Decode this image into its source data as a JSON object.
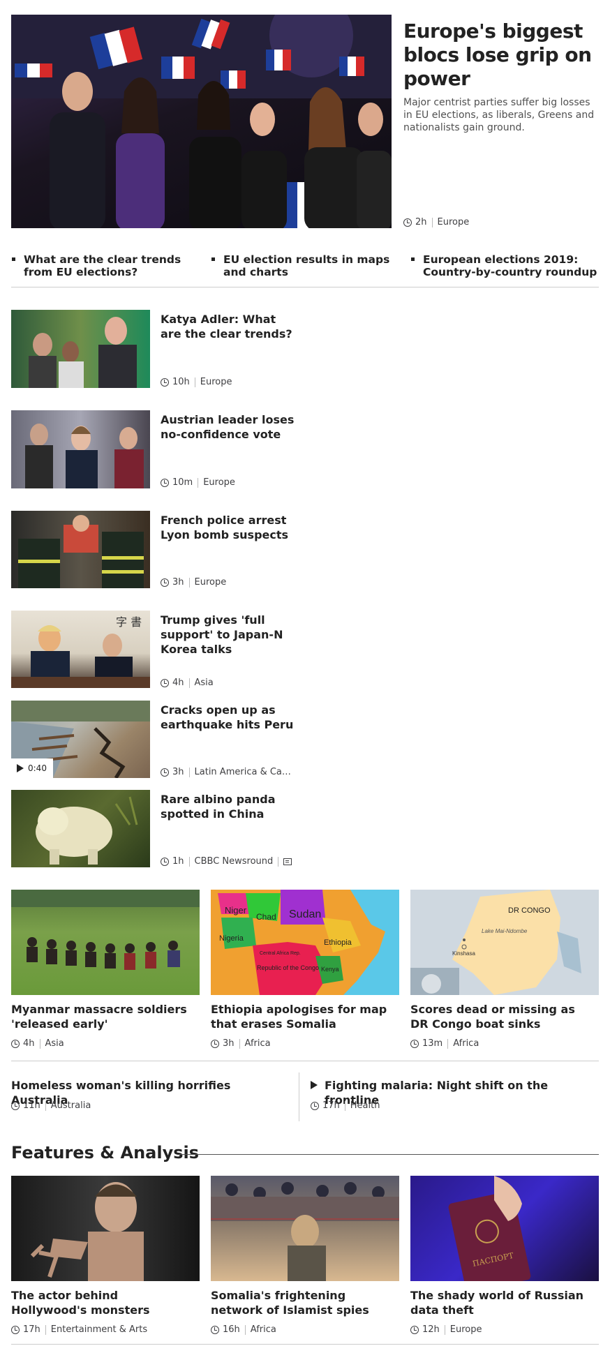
{
  "lead": {
    "headline": "Europe's biggest blocs lose grip on power",
    "summary": "Major centrist parties suffer big losses in EU elections, as liberals, Greens and nationalists gain ground.",
    "time": "2h",
    "section": "Europe"
  },
  "related_links": [
    "What are the clear trends from EU elections?",
    "EU election results in maps and charts",
    "European elections 2019: Country-by-country roundup"
  ],
  "stories": [
    {
      "headline": "Katya Adler: What are the clear trends?",
      "time": "10h",
      "section": "Europe"
    },
    {
      "headline": "Austrian leader loses no-confidence vote",
      "time": "10m",
      "section": "Europe"
    },
    {
      "headline": "French police arrest Lyon bomb suspects",
      "time": "3h",
      "section": "Europe"
    },
    {
      "headline": "Trump gives 'full support' to Japan-N Korea talks",
      "time": "4h",
      "section": "Asia"
    },
    {
      "headline": "Cracks open up as earthquake hits Peru",
      "time": "3h",
      "section": "Latin America & Ca…",
      "video_duration": "0:40"
    },
    {
      "headline": "Rare albino panda spotted in China",
      "time": "1h",
      "section": "CBBC Newsround"
    }
  ],
  "grid": [
    {
      "headline": "Myanmar massacre soldiers 'released early'",
      "time": "4h",
      "section": "Asia"
    },
    {
      "headline": "Ethiopia apologises for map that erases Somalia",
      "time": "3h",
      "section": "Africa"
    },
    {
      "headline": "Scores dead or missing as DR Congo boat sinks",
      "time": "13m",
      "section": "Africa"
    }
  ],
  "map_labels": {
    "africa": [
      "Niger",
      "Chad",
      "Sudan",
      "Nigeria",
      "Ethiopia",
      "Republic of the Congo",
      "Kenya",
      "Central Africa Rep."
    ],
    "congo": [
      "DR CONGO",
      "Lake Mai-Ndombe",
      "Kinshasa"
    ]
  },
  "text_row": [
    {
      "headline": "Homeless woman's killing horrifies Australia",
      "time": "11h",
      "section": "Australia"
    },
    {
      "headline": "Fighting malaria: Night shift on the frontline",
      "time": "17h",
      "section": "Health"
    }
  ],
  "features": {
    "title": "Features & Analysis",
    "items": [
      {
        "headline": "The actor behind Hollywood's monsters",
        "time": "17h",
        "section": "Entertainment & Arts"
      },
      {
        "headline": "Somalia's frightening network of Islamist spies",
        "time": "16h",
        "section": "Africa"
      },
      {
        "headline": "The shady world of Russian data theft",
        "time": "12h",
        "section": "Europe"
      }
    ]
  },
  "colors": {
    "text": "#222222",
    "meta": "#3f3f42",
    "rule": "#cccccc"
  }
}
